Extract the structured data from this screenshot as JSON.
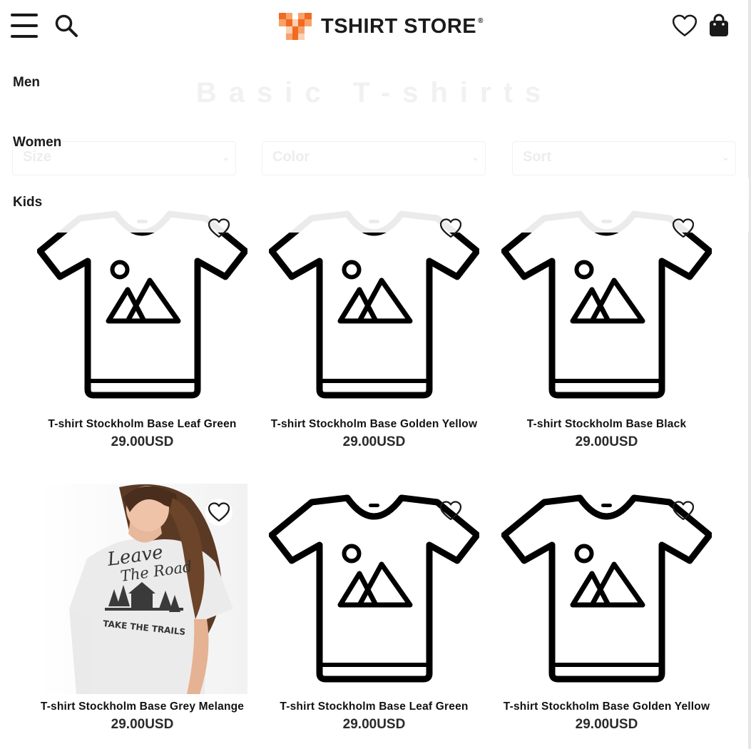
{
  "brand": {
    "name": "TSHIRT STORE",
    "reg_mark": "®",
    "colors": [
      "#f26a21",
      "#f7a26b",
      "#fbd0b3"
    ]
  },
  "header": {
    "menu_icon": "hamburger-icon",
    "search_icon": "search-icon",
    "wishlist_icon": "heart-icon",
    "cart_icon": "shopping-bag-icon"
  },
  "side_menu": [
    "Men",
    "Women",
    "Kids"
  ],
  "page_title": "Basic T-shirts",
  "filters": [
    {
      "label": "Size"
    },
    {
      "label": "Color"
    },
    {
      "label": "Sort"
    }
  ],
  "products": [
    {
      "name": "T-shirt Stockholm Base Leaf Green",
      "price": "29.00USD",
      "image": "placeholder-tshirt-icon"
    },
    {
      "name": "T-shirt Stockholm Base Golden Yellow",
      "price": "29.00USD",
      "image": "placeholder-tshirt-icon"
    },
    {
      "name": "T-shirt Stockholm Base Black",
      "price": "29.00USD",
      "image": "placeholder-tshirt-icon"
    },
    {
      "name": "T-shirt Stockholm Base Grey Melange",
      "price": "29.00USD",
      "image": "product-photo"
    },
    {
      "name": "T-shirt Stockholm Base Leaf Green",
      "price": "29.00USD",
      "image": "placeholder-tshirt-icon"
    },
    {
      "name": "T-shirt Stockholm Base Golden Yellow",
      "price": "29.00USD",
      "image": "placeholder-tshirt-icon"
    }
  ],
  "photo_print": {
    "line1": "Leave",
    "line2": "The Road",
    "line3": "TAKE THE TRAILS"
  }
}
